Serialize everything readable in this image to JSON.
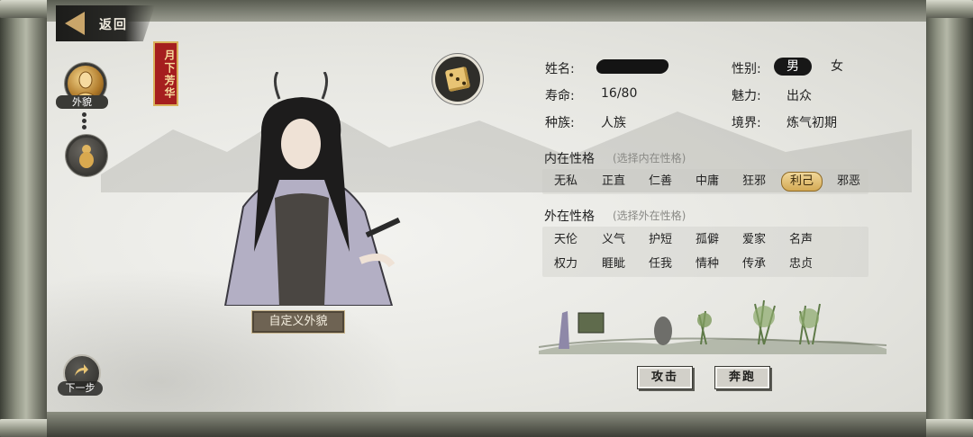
{
  "nav": {
    "back_label": "返回",
    "next_label": "下一步"
  },
  "side": {
    "appearance_label": "外貌"
  },
  "banner": {
    "text": "月下芳华"
  },
  "custom_button": "自定义外貌",
  "info": {
    "name_label": "姓名:",
    "name_value": "",
    "gender_label": "性别:",
    "gender_options": [
      "男",
      "女"
    ],
    "gender_selected": "男",
    "lifespan_label": "寿命:",
    "lifespan_value": "16/80",
    "charm_label": "魅力:",
    "charm_value": "出众",
    "race_label": "种族:",
    "race_value": "人族",
    "realm_label": "境界:",
    "realm_value": "炼气初期"
  },
  "inner": {
    "title": "内在性格",
    "hint": "(选择内在性格)",
    "options": [
      "无私",
      "正直",
      "仁善",
      "中庸",
      "狂邪",
      "利己",
      "邪恶"
    ],
    "selected": "利己"
  },
  "outer": {
    "title": "外在性格",
    "hint": "(选择外在性格)",
    "row1": [
      "天伦",
      "义气",
      "护短",
      "孤僻",
      "爱家",
      "名声"
    ],
    "row2": [
      "权力",
      "睚眦",
      "任我",
      "情种",
      "传承",
      "忠贞"
    ]
  },
  "actions": {
    "attack": "攻击",
    "flee": "奔跑"
  },
  "colors": {
    "accent_gold": "#d4aa55",
    "banner_red": "#a51e1e"
  },
  "icons": [
    "back-arrow-icon",
    "appearance-bust-icon",
    "gourd-icon",
    "dice-icon",
    "next-arrow-icon"
  ]
}
